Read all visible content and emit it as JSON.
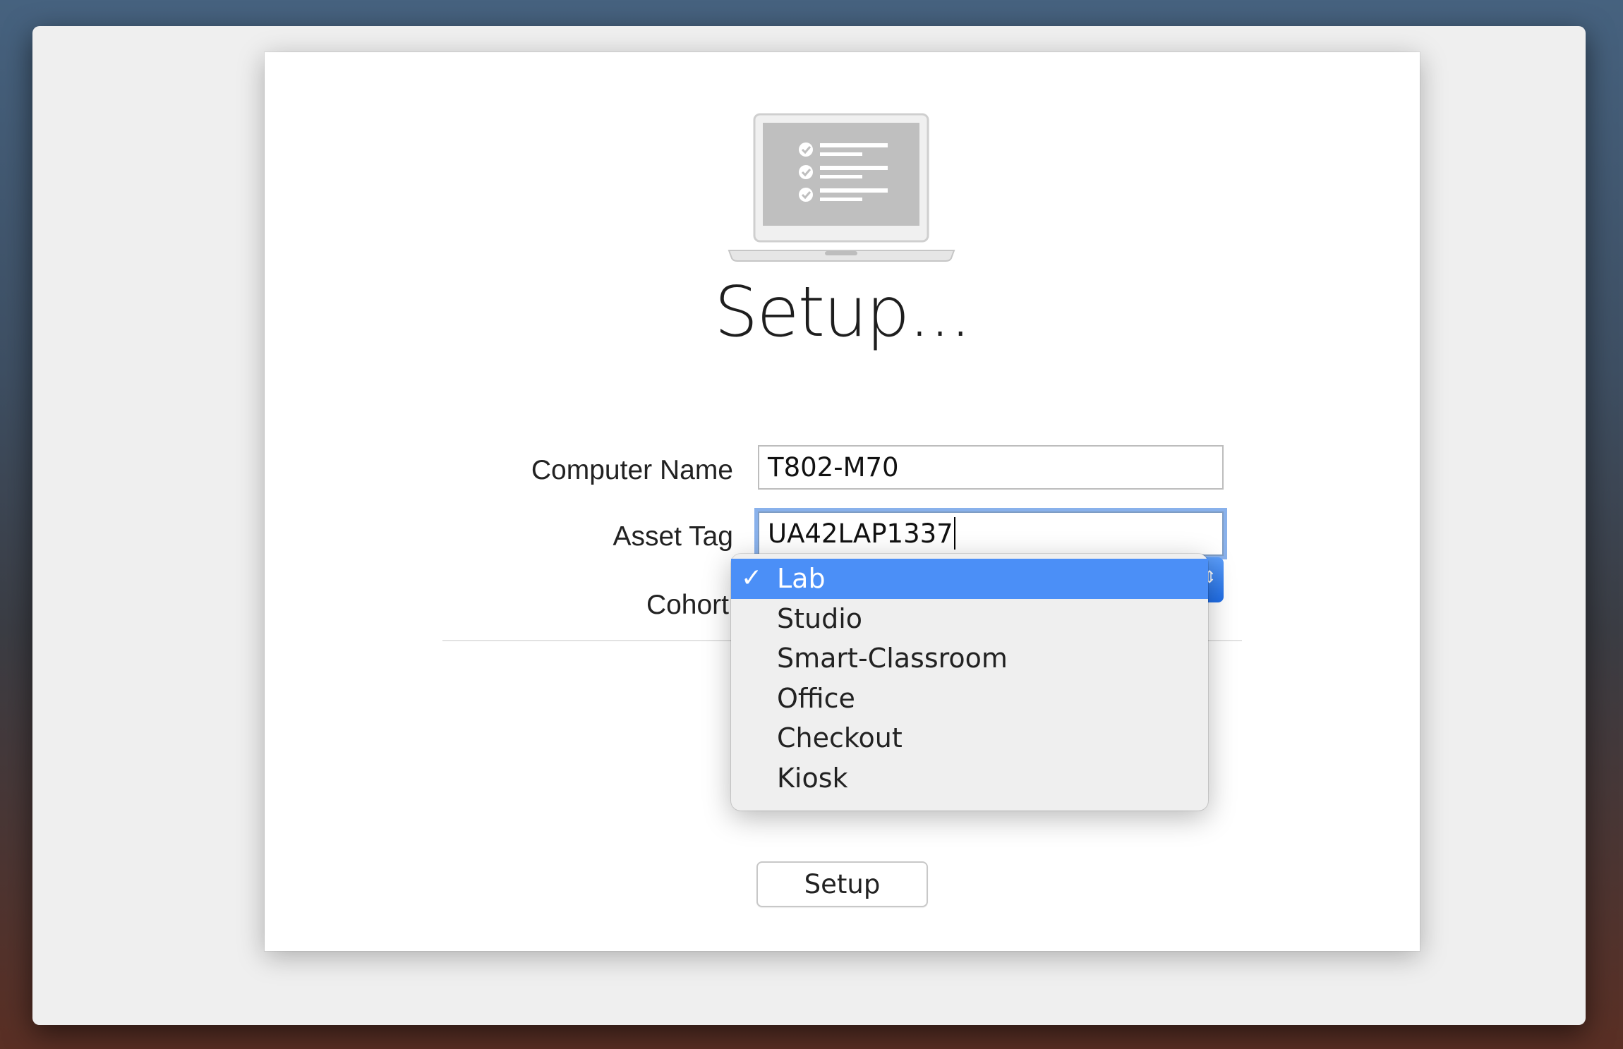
{
  "title": "Setup...",
  "form": {
    "computer_name": {
      "label": "Computer Name",
      "value": "T802-M70"
    },
    "asset_tag": {
      "label": "Asset Tag",
      "value": "UA42LAP1337"
    },
    "cohort": {
      "label": "Cohort",
      "selected": "Lab",
      "options": [
        "Lab",
        "Studio",
        "Smart-Classroom",
        "Office",
        "Checkout",
        "Kiosk"
      ]
    }
  },
  "buttons": {
    "setup_label": "Setup"
  },
  "icons": {
    "header": "laptop-checklist-icon",
    "check": "checkmark-icon",
    "popup_arrows": "up-down-arrows-icon"
  },
  "colors": {
    "accent": "#4b8ff7",
    "focus_ring": "#74a3e8"
  }
}
